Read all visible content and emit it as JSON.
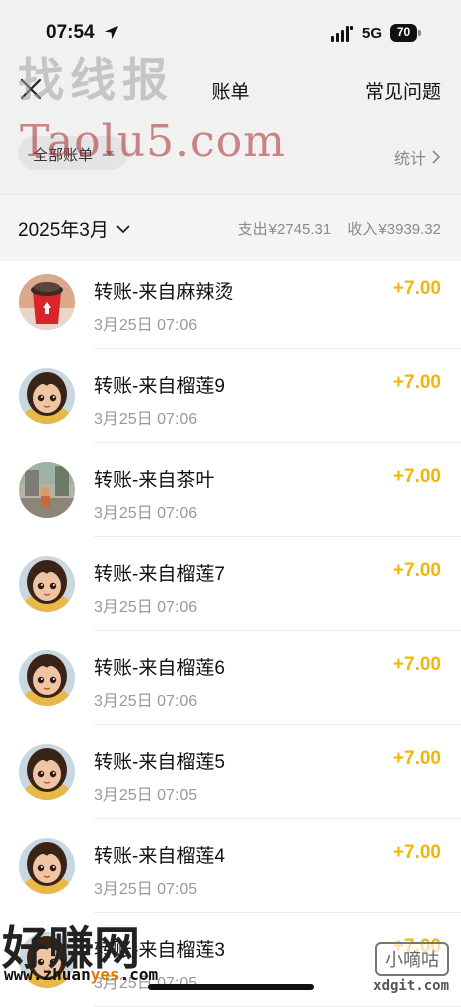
{
  "status_bar": {
    "time": "07:54",
    "network": "5G",
    "battery": "70"
  },
  "nav": {
    "title": "账单",
    "faq": "常见问题"
  },
  "filter": {
    "all_bills": "全部账单",
    "stats": "统计"
  },
  "summary": {
    "month": "2025年3月",
    "expense_label": "支出",
    "expense_value": "¥2745.31",
    "income_label": "收入",
    "income_value": "¥3939.32"
  },
  "transactions": [
    {
      "title": "转账-来自麻辣烫",
      "time": "3月25日 07:06",
      "amount": "+7.00",
      "avatar": "coffee-cup"
    },
    {
      "title": "转账-来自榴莲9",
      "time": "3月25日 07:06",
      "amount": "+7.00",
      "avatar": "cartoon-girl"
    },
    {
      "title": "转账-来自茶叶",
      "time": "3月25日 07:06",
      "amount": "+7.00",
      "avatar": "street-photo"
    },
    {
      "title": "转账-来自榴莲7",
      "time": "3月25日 07:06",
      "amount": "+7.00",
      "avatar": "cartoon-girl"
    },
    {
      "title": "转账-来自榴莲6",
      "time": "3月25日 07:06",
      "amount": "+7.00",
      "avatar": "cartoon-girl"
    },
    {
      "title": "转账-来自榴莲5",
      "time": "3月25日 07:05",
      "amount": "+7.00",
      "avatar": "cartoon-girl"
    },
    {
      "title": "转账-来自榴莲4",
      "time": "3月25日 07:05",
      "amount": "+7.00",
      "avatar": "cartoon-girl"
    },
    {
      "title": "转账-来自榴莲3",
      "time": "3月25日 07:05",
      "amount": "+7.00",
      "avatar": "cartoon-girl"
    }
  ],
  "watermarks": {
    "top_cn": "找线报",
    "top_en": "Taolu5.com",
    "bottom_left": "好赚网",
    "bottom_left_url_a": "www.zhuan",
    "bottom_left_url_b": "yes",
    "bottom_left_url_c": ".com",
    "bottom_right": "小嘀咕",
    "bottom_right_url": "xdgit.com"
  },
  "colors": {
    "accent_amount": "#f2b705",
    "header_bg": "#f1f1f1",
    "summary_bg": "#f4f4f4"
  },
  "icons": {
    "close": "close-icon",
    "location": "location-arrow-icon",
    "signal": "signal-icon",
    "battery": "battery-icon",
    "caret": "caret-down-icon",
    "chevron_right": "chevron-right-icon",
    "chevron_down": "chevron-down-icon"
  }
}
